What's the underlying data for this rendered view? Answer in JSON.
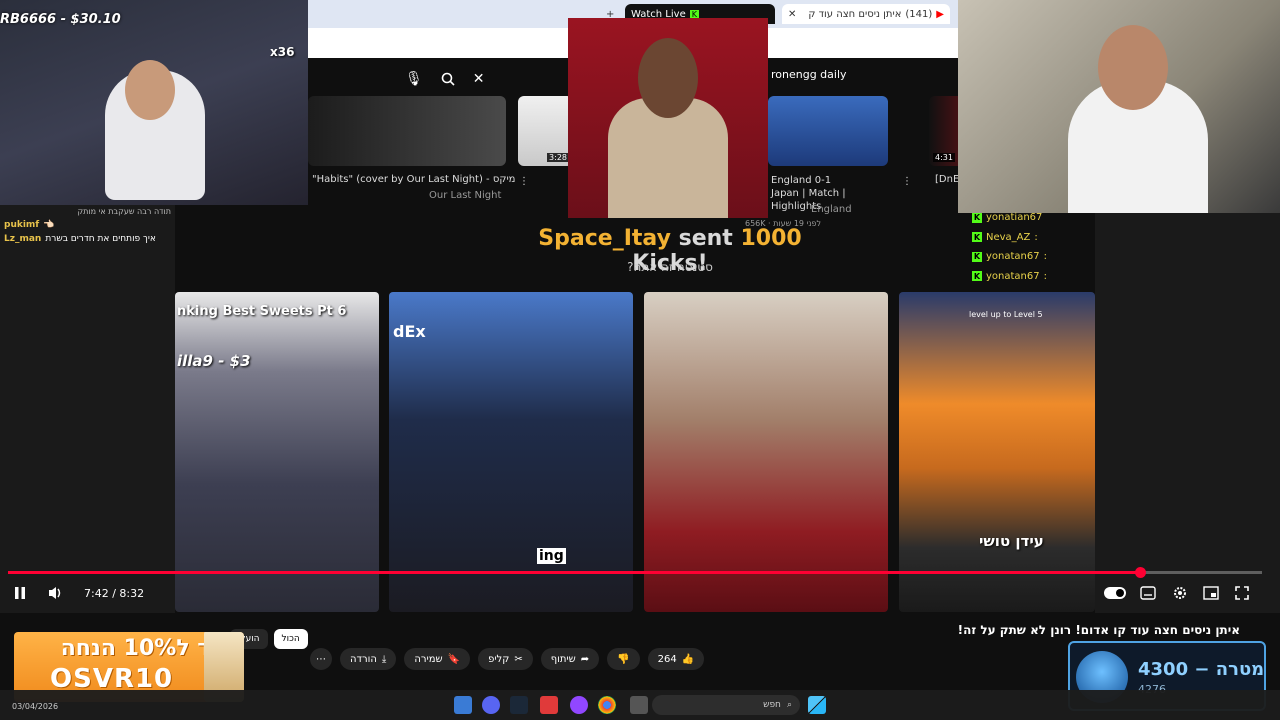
{
  "overlay": {
    "donation_ticker": "RB6666 - $30.10",
    "cam1_badge": "x36"
  },
  "browser": {
    "tab1": "Watch Live",
    "tab2_count": "(141)",
    "tab2_title": "איתן ניסים חצה עוד ק"
  },
  "youtube": {
    "search_chip": "ronengg daily",
    "row": [
      {
        "title": "\"Habits\" (cover by Our Last Night) - מיקס",
        "channel": "Our Last Night",
        "duration": ""
      },
      {
        "title": "",
        "channel": "",
        "duration": "3:28"
      },
      {
        "title": "England 0-1 Japan | Match | Highlights",
        "channel": "England",
        "duration": ""
      },
      {
        "title": "[DnE",
        "channel": "",
        "duration": "4:31"
      }
    ],
    "row_meta": "656K · לפני 19 שעות",
    "donation": {
      "name": "Space_Itay",
      "sent": "sent",
      "amount": "1000",
      "unit": "Kicks!",
      "sub": "סטנטה זה אתה?"
    },
    "shorts": [
      {
        "overlay": "nking Best Sweets Pt 6",
        "sub": "illa9 - $3"
      },
      {
        "overlay": "dEx",
        "sub": "ing"
      },
      {
        "overlay": "",
        "sub": ""
      },
      {
        "overlay": "עידן טושי",
        "sub": "level up to Level 5"
      }
    ]
  },
  "chat_left": [
    {
      "user": "pukimf",
      "msg": "👈🏻"
    },
    {
      "user": "Lz_man",
      "msg": "איך פותחים את חדרים בשרת"
    }
  ],
  "chat_left_header": "תודה רבה שעקבת אי מותק",
  "chat_right": [
    {
      "user": "yonatian67",
      "msg": ""
    },
    {
      "user": "Neva_AZ",
      "msg": ":"
    },
    {
      "user": "yonatan67",
      "msg": ":"
    },
    {
      "user": "yonatan67",
      "msg": ":"
    }
  ],
  "player": {
    "time": "7:42 / 8:32",
    "progress": 0.903
  },
  "video": {
    "title": "איתן ניסים חצה עוד קו אדום! רונן לא שתק על זה!",
    "likes": "264",
    "share": "שיתוף",
    "clip": "קליפ",
    "save": "שמירה",
    "download": "הורדה"
  },
  "chips": [
    "הכול",
    "הועלו"
  ],
  "promo": {
    "line1": "קוד ל10% הנחה",
    "line2": "OSVR10"
  },
  "goal": {
    "label": "מטרה",
    "value": "4300",
    "current": "4276"
  },
  "taskbar": {
    "search": "חפש",
    "date": "03/04/2026"
  }
}
